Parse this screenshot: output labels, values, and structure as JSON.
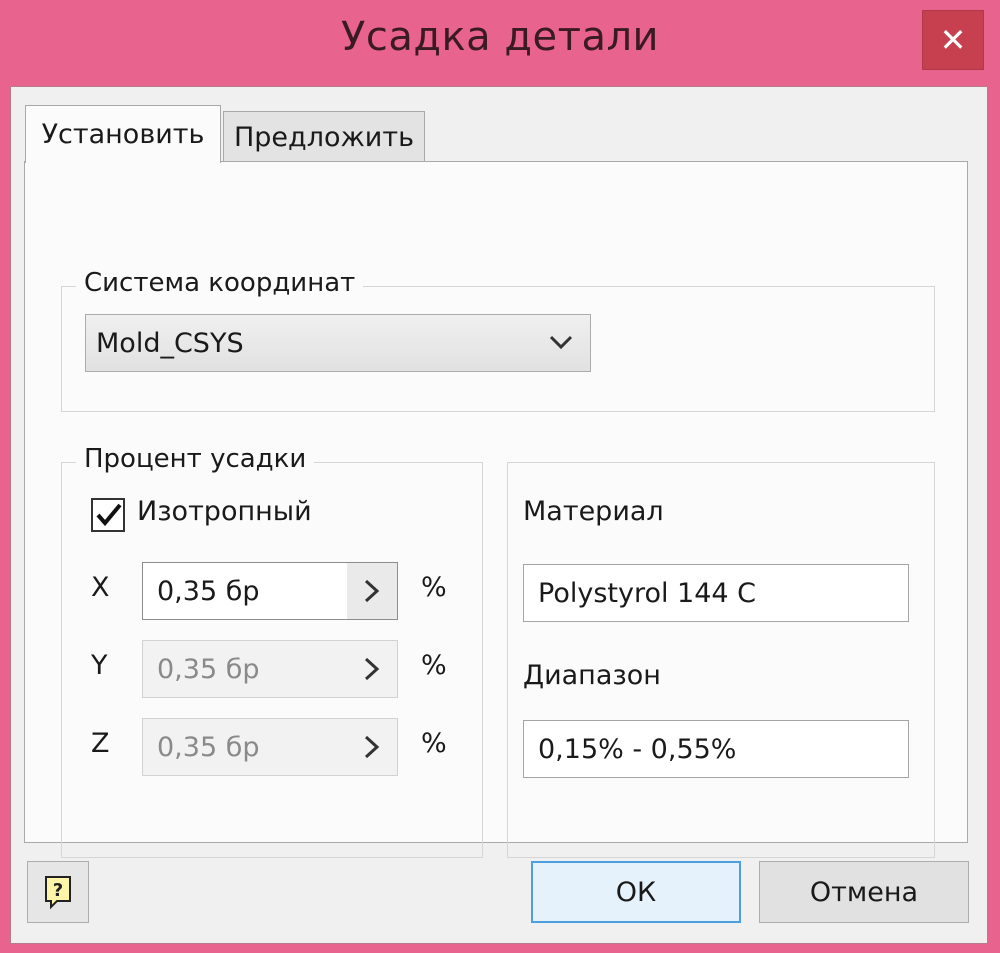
{
  "window": {
    "title": "Усадка детали",
    "close_glyph": "✕"
  },
  "tabs": [
    {
      "label": "Установить",
      "active": true
    },
    {
      "label": "Предложить",
      "active": false
    }
  ],
  "coord_system": {
    "group_label": "Система координат",
    "selected": "Mold_CSYS"
  },
  "shrinkage": {
    "group_label": "Процент усадки",
    "isotropic_label": "Изотропный",
    "isotropic_checked": true,
    "axes": [
      {
        "axis": "X",
        "value": "0,35 бр",
        "unit": "%",
        "enabled": true
      },
      {
        "axis": "Y",
        "value": "0,35 бр",
        "unit": "%",
        "enabled": false
      },
      {
        "axis": "Z",
        "value": "0,35 бр",
        "unit": "%",
        "enabled": false
      }
    ]
  },
  "material": {
    "material_label": "Материал",
    "material_value": "Polystyrol 144 C",
    "range_label": "Диапазон",
    "range_value": "0,15% - 0,55%"
  },
  "buttons": {
    "help_icon": "help-icon",
    "ok": "ОК",
    "cancel": "Отмена"
  },
  "colors": {
    "accent": "#e8648e",
    "close": "#c7404f",
    "ok_border": "#4d9ee0"
  }
}
